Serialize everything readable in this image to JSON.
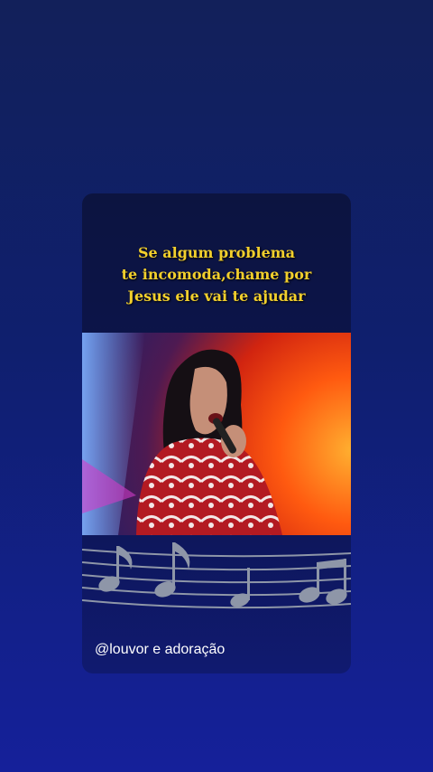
{
  "post": {
    "caption_lines": [
      "Se algum problema",
      "te incomoda,chame por",
      "Jesus ele vai te ajudar"
    ],
    "handle": "@louvor e adoração"
  },
  "icons": {
    "music_notes": "music-notes-icon"
  },
  "colors": {
    "caption": "#f2cf2c",
    "background": "#0f1f6e",
    "notes": "#8e96a8"
  }
}
